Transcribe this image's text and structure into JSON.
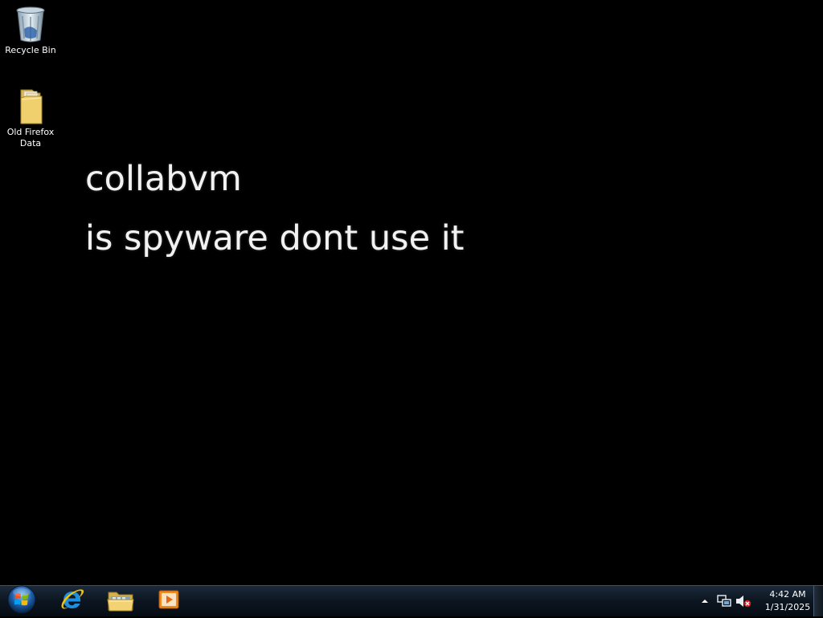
{
  "desktop": {
    "icons": [
      {
        "label": "Recycle Bin",
        "icon": "recycle-bin-icon"
      },
      {
        "label": "Old Firefox Data",
        "icon": "folder-icon"
      }
    ],
    "wallpaper_lines": [
      "collabvm",
      "is spyware dont use it"
    ]
  },
  "taskbar": {
    "start_icon": "windows-orb-icon",
    "pinned": [
      {
        "icon": "internet-explorer-icon"
      },
      {
        "icon": "file-explorer-icon"
      },
      {
        "icon": "media-player-icon"
      }
    ],
    "tray": {
      "icons": [
        "show-hidden-icons-arrow",
        "network-icon",
        "volume-muted-icon"
      ],
      "time": "4:42 AM",
      "date": "1/31/2025"
    }
  },
  "colors": {
    "desktop_bg": "#000000",
    "taskbar_bg": "#0d1722",
    "text": "#ffffff"
  }
}
